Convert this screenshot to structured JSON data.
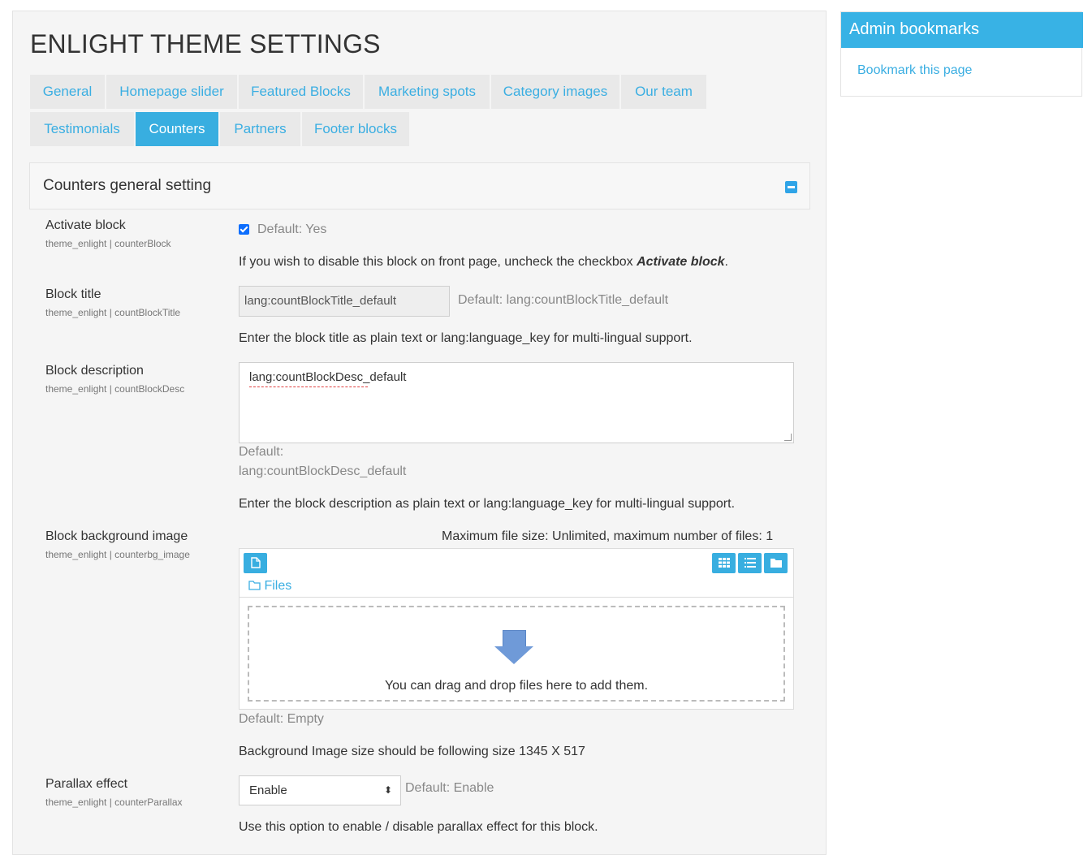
{
  "page": {
    "title": "ENLIGHT THEME SETTINGS"
  },
  "tabs": [
    {
      "label": "General"
    },
    {
      "label": "Homepage slider"
    },
    {
      "label": "Featured Blocks"
    },
    {
      "label": "Marketing spots"
    },
    {
      "label": "Category images"
    },
    {
      "label": "Our team"
    },
    {
      "label": "Testimonials"
    },
    {
      "label": "Counters"
    },
    {
      "label": "Partners"
    },
    {
      "label": "Footer blocks"
    }
  ],
  "active_tab": "Counters",
  "section": {
    "title": "Counters general setting",
    "collapse_icon": "minus-square-icon"
  },
  "settings": {
    "activate": {
      "label": "Activate block",
      "sub": "theme_enlight | counterBlock",
      "checked": true,
      "default": "Default: Yes",
      "desc_pre": "If you wish to disable this block on front page, uncheck the checkbox ",
      "desc_em": "Activate block",
      "desc_post": "."
    },
    "title": {
      "label": "Block title",
      "sub": "theme_enlight | countBlockTitle",
      "value": "lang:countBlockTitle_default",
      "default": "Default: lang:countBlockTitle_default",
      "desc": "Enter the block title as plain text or lang:language_key for multi-lingual support."
    },
    "description": {
      "label": "Block description",
      "sub": "theme_enlight | countBlockDesc",
      "value": "lang:countBlockDesc_default",
      "default_label": "Default:",
      "default_value": "lang:countBlockDesc_default",
      "desc": "Enter the block description as plain text or lang:language_key for multi-lingual support."
    },
    "bg_image": {
      "label": "Block background image",
      "sub": "theme_enlight | counterbg_image",
      "max_info": "Maximum file size: Unlimited, maximum number of files: 1",
      "files_label": "Files",
      "dropzone_text": "You can drag and drop files here to add them.",
      "default": "Default: Empty",
      "desc": "Background Image size should be following size 1345 X 517",
      "icons": [
        "add-file-icon",
        "grid-view-icon",
        "list-view-icon",
        "folder-view-icon",
        "folder-icon",
        "down-arrow-icon"
      ]
    },
    "parallax": {
      "label": "Parallax effect",
      "sub": "theme_enlight | counterParallax",
      "value": "Enable",
      "default": "Default: Enable",
      "desc": "Use this option to enable / disable parallax effect for this block."
    }
  },
  "sidebar": {
    "title": "Admin bookmarks",
    "link": "Bookmark this page"
  },
  "colors": {
    "accent": "#38aee0",
    "link": "#3aaee2",
    "panel_bg": "#f5f5f5"
  }
}
